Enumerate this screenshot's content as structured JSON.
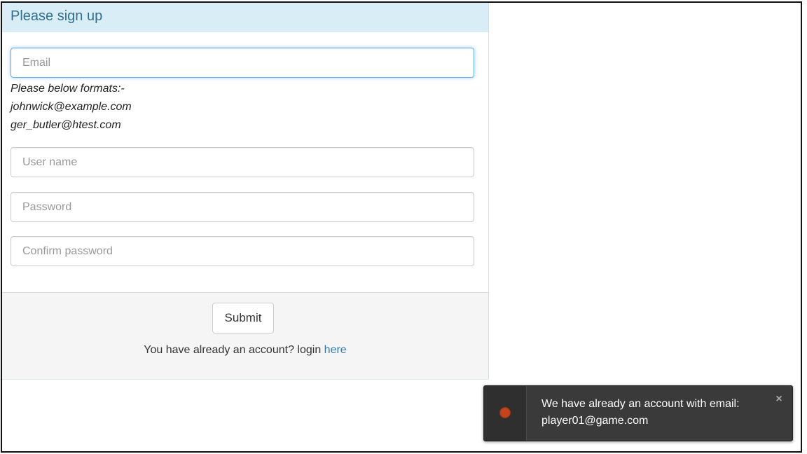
{
  "panel": {
    "title": "Please sign up"
  },
  "form": {
    "email": {
      "placeholder": "Email",
      "value": ""
    },
    "hint": {
      "line1": "Please below formats:-",
      "line2": "johnwick@example.com",
      "line3": "ger_butler@htest.com"
    },
    "username": {
      "placeholder": "User name",
      "value": ""
    },
    "password": {
      "placeholder": "Password",
      "value": ""
    },
    "confirm_password": {
      "placeholder": "Confirm password",
      "value": ""
    }
  },
  "footer": {
    "submit_label": "Submit",
    "login_prompt": "You have already an account? login ",
    "login_link": "here"
  },
  "toast": {
    "icon": "error-dot-icon",
    "status_color": "#c0451c",
    "message_line1": "We have already an account with email:",
    "message_line2": "player01@game.com",
    "close_icon": "close-icon"
  },
  "colors": {
    "heading_bg": "#d9edf7",
    "heading_text": "#31708f",
    "link": "#337ab7",
    "footer_bg": "#f5f5f5",
    "toast_bg": "#3a3a3a"
  }
}
